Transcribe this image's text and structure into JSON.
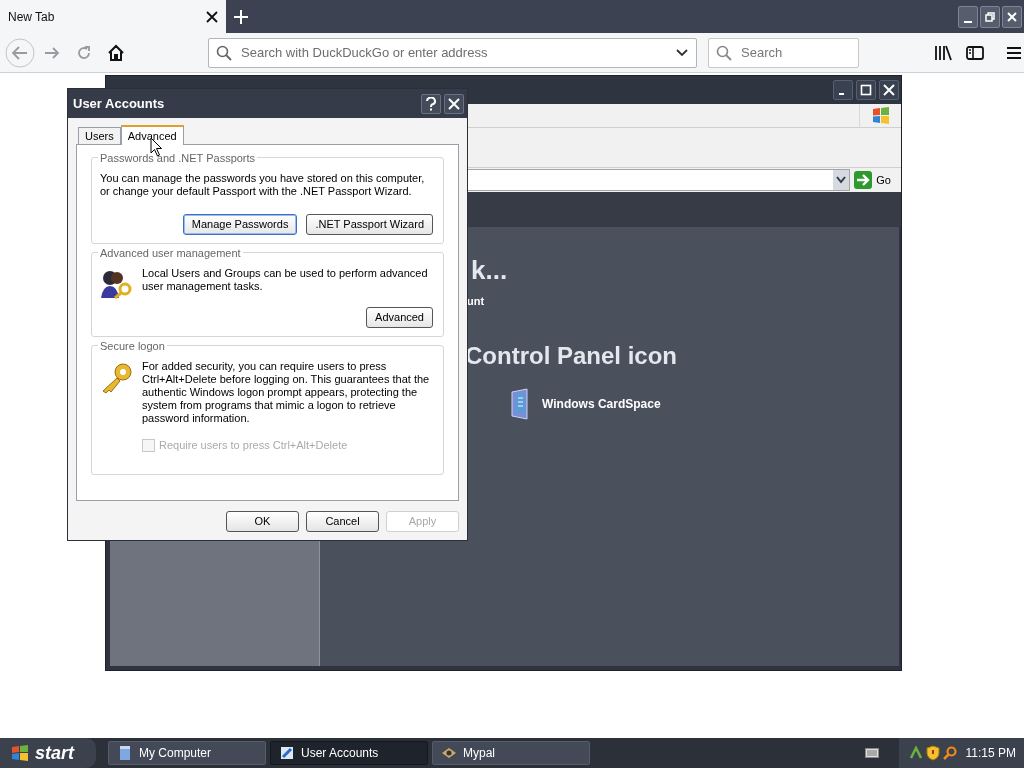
{
  "browser": {
    "tabs": [
      {
        "label": "New Tab",
        "selected": true
      }
    ],
    "address": {
      "placeholder": "Search with DuckDuckGo or enter address"
    },
    "search": {
      "placeholder": "Search"
    }
  },
  "back_window": {
    "address_go": "Go",
    "heading": "k...",
    "link": "unt",
    "section_heading": "Control Panel icon",
    "items": [
      "Windows CardSpace"
    ]
  },
  "dialog": {
    "title": "User Accounts",
    "tabs": [
      {
        "label": "Users",
        "selected": false
      },
      {
        "label": "Advanced",
        "selected": true
      }
    ],
    "groups": [
      {
        "kind": "passwords",
        "title": "Passwords and .NET Passports",
        "text": "You can manage the passwords you have stored on this computer, or change your default Passport with the .NET Passport Wizard.",
        "buttons": [
          {
            "label": "Manage Passwords",
            "focused": true
          },
          {
            "label": ".NET Passport Wizard",
            "focused": false
          }
        ]
      },
      {
        "kind": "users",
        "title": "Advanced user management",
        "text": "Local Users and Groups can be used to perform advanced user management tasks.",
        "buttons": [
          {
            "label": "Advanced",
            "focused": false
          }
        ]
      },
      {
        "kind": "logon",
        "title": "Secure logon",
        "text": "For added security, you can require users to press Ctrl+Alt+Delete before logging on. This guarantees that the authentic Windows logon prompt appears, protecting the system from programs that mimic a logon to retrieve password information.",
        "checkbox": {
          "label": "Require users to press Ctrl+Alt+Delete",
          "checked": false,
          "disabled": true
        }
      }
    ],
    "buttons": [
      {
        "label": "OK",
        "disabled": false
      },
      {
        "label": "Cancel",
        "disabled": false
      },
      {
        "label": "Apply",
        "disabled": true
      }
    ]
  },
  "taskbar": {
    "start": "start",
    "items": [
      {
        "label": "My Computer",
        "selected": false
      },
      {
        "label": "User Accounts",
        "selected": true
      },
      {
        "label": "Mypal",
        "selected": false
      }
    ],
    "clock": "11:15 PM"
  }
}
